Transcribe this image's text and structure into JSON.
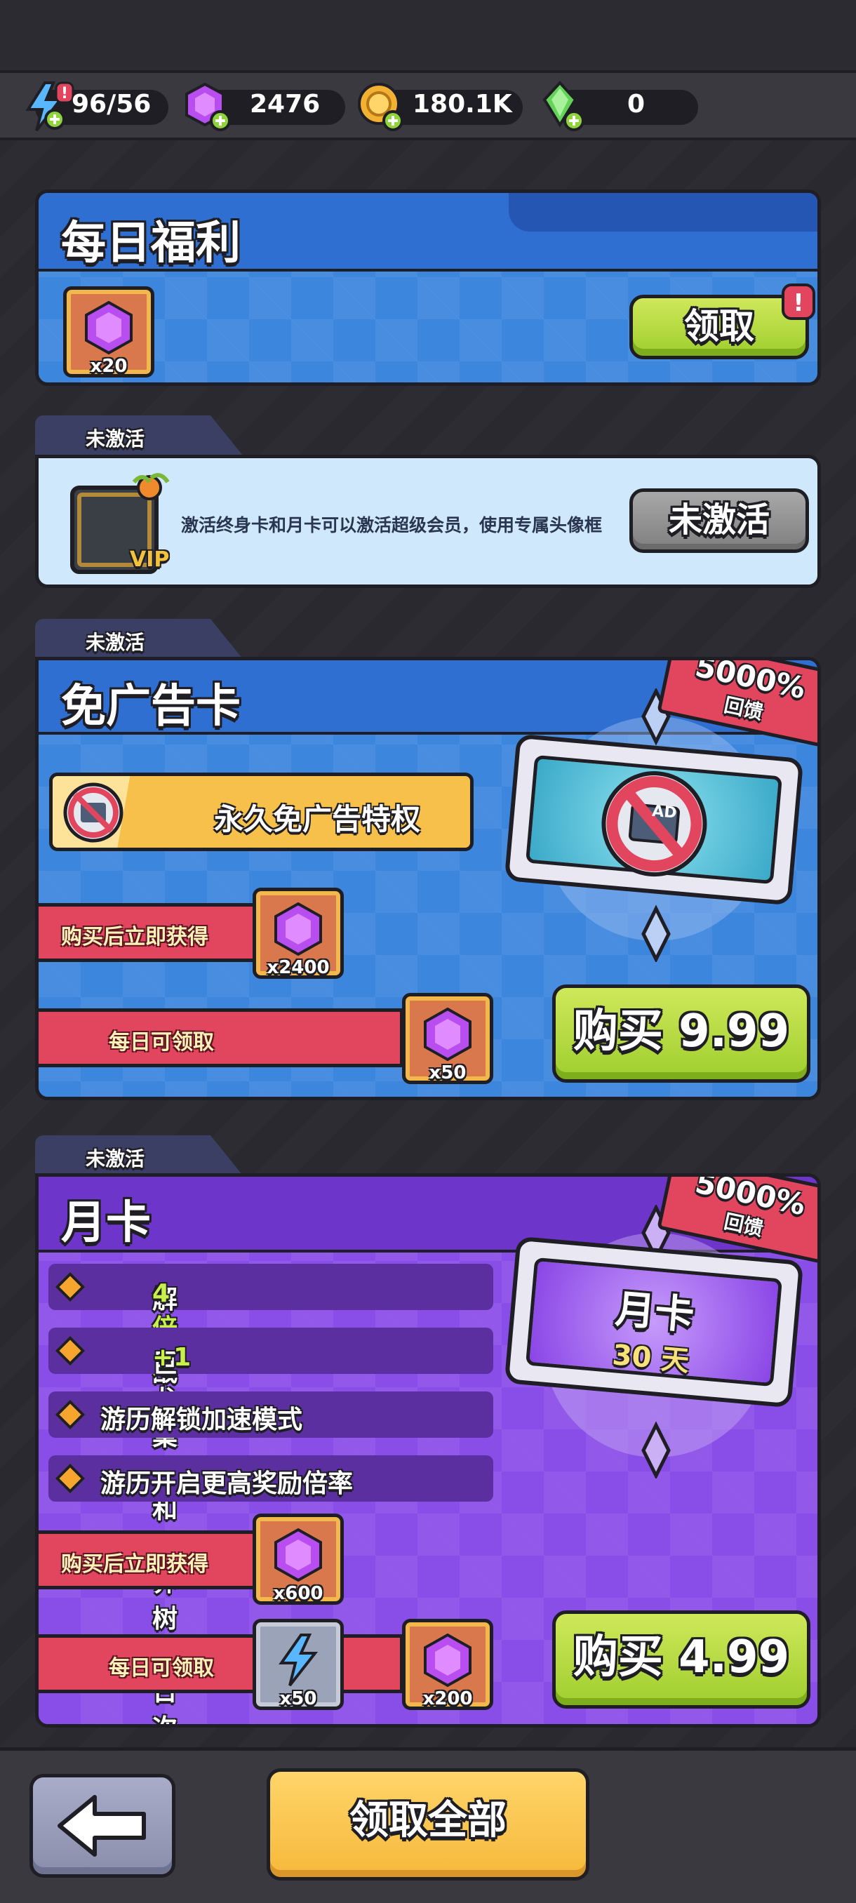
{
  "resources": {
    "energy": "96/56",
    "gems": "2476",
    "coins": "180.1K",
    "crystals": "0"
  },
  "daily": {
    "title": "每日福利",
    "item_count": "x20",
    "claim_label": "领取"
  },
  "vip": {
    "tab": "未激活",
    "description": "激活终身卡和月卡可以激活超级会员，使用专属头像框",
    "frame_label": "VIP",
    "status_label": "未激活"
  },
  "adfree": {
    "tab": "未激活",
    "title": "免广告卡",
    "privilege": "永久免广告特权",
    "icon_text": "AD",
    "buy_now_label": "购买后立即获得",
    "buy_now_count": "x2400",
    "daily_label": "每日可领取",
    "daily_count": "x50",
    "badge_percent": "5000%",
    "badge_text": "回馈",
    "buy_label": "购买 9.99"
  },
  "monthly": {
    "tab": "未激活",
    "title": "月卡",
    "features": [
      {
        "text": "解锁 战斗",
        "highlight": "4倍速"
      },
      {
        "text": "巨龙巢穴和星界树每日次数 ",
        "highlight": "+1"
      },
      {
        "text": "游历解锁加速模式",
        "highlight": ""
      },
      {
        "text": "游历开启更高奖励倍率",
        "highlight": ""
      }
    ],
    "ticket_title": "月卡",
    "ticket_days": "30 天",
    "buy_now_label": "购买后立即获得",
    "buy_now_count": "x600",
    "daily_label": "每日可领取",
    "daily_energy_count": "x50",
    "daily_gem_count": "x200",
    "badge_percent": "5000%",
    "badge_text": "回馈",
    "buy_label": "购买 4.99"
  },
  "footer": {
    "claim_all_label": "领取全部"
  }
}
